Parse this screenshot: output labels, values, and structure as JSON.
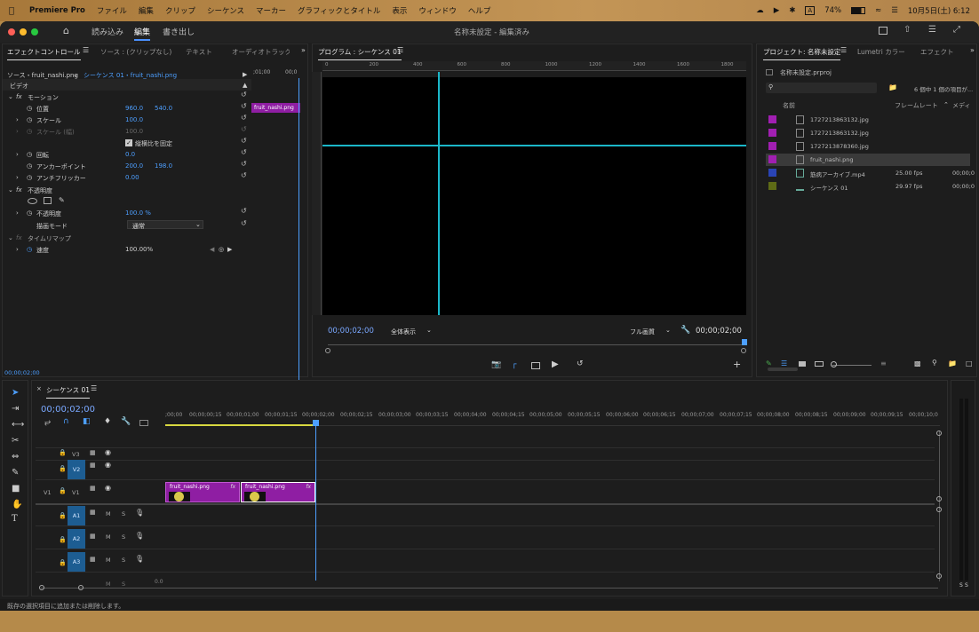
{
  "menubar": {
    "app": "Premiere Pro",
    "items": [
      "ファイル",
      "編集",
      "クリップ",
      "シーケンス",
      "マーカー",
      "グラフィックとタイトル",
      "表示",
      "ウィンドウ",
      "ヘルプ"
    ],
    "battery": "74%",
    "input": "A",
    "datetime": "10月5日(土) 6:12"
  },
  "titlebar": {
    "workspaces": [
      "読み込み",
      "編集",
      "書き出し"
    ],
    "active_workspace": "編集",
    "title": "名称未設定 - 編集済み"
  },
  "effect_controls": {
    "tabs": [
      "エフェクトコントロール",
      "ソース : (クリップなし)",
      "テキスト",
      "オーディオトラック"
    ],
    "source_label": "ソース・fruit_nashi.png",
    "sequence_label": "シーケンス 01・fruit_nashi.png",
    "clip_time_start": ";01;00",
    "clip_time_end": "00;0",
    "clip_name": "fruit_nashi.png",
    "section_video": "ビデオ",
    "motion": "モーション",
    "position_label": "位置",
    "position_x": "960.0",
    "position_y": "540.0",
    "scale_label": "スケール",
    "scale_value": "100.0",
    "scale_w_label": "スケール (幅)",
    "scale_w_value": "100.0",
    "uniform_scale": "縦横比を固定",
    "rotation_label": "回転",
    "rotation_value": "0.0",
    "anchor_label": "アンカーポイント",
    "anchor_x": "200.0",
    "anchor_y": "198.0",
    "antiflicker_label": "アンチフリッカー",
    "antiflicker_value": "0.00",
    "opacity_section": "不透明度",
    "opacity_label": "不透明度",
    "opacity_value": "100.0 %",
    "blend_label": "描画モード",
    "blend_value": "通常",
    "time_remap": "タイムリマップ",
    "speed_label": "速度",
    "speed_value": "100.00%",
    "bottom_time": "00;00;02;00"
  },
  "program": {
    "title": "プログラム : シーケンス 01",
    "ruler_labels": [
      "0",
      "200",
      "400",
      "600",
      "800",
      "1000",
      "1200",
      "1400",
      "1600",
      "1800"
    ],
    "timecode": "00;00;02;00",
    "fit": "全体表示",
    "quality": "フル画質",
    "duration": "00;00;02;00"
  },
  "project": {
    "tabs": [
      "プロジェクト: 名称未設定",
      "Lumetri カラー",
      "エフェクト"
    ],
    "file": "名称未設定.prproj",
    "count": "6 個中 1 個の項目が...",
    "col_name": "名前",
    "col_framerate": "フレームレート",
    "col_media": "メディ",
    "items": [
      {
        "name": "1727213863132.jpg",
        "fps": "",
        "media": "",
        "color": "#a11fb2"
      },
      {
        "name": "1727213863132.jpg",
        "fps": "",
        "media": "",
        "color": "#a11fb2"
      },
      {
        "name": "1727213878360.jpg",
        "fps": "",
        "media": "",
        "color": "#a11fb2"
      },
      {
        "name": "fruit_nashi.png",
        "fps": "",
        "media": "",
        "color": "#a11fb2"
      },
      {
        "name": "筋病アーカイブ.mp4",
        "fps": "25.00 fps",
        "media": "00;00;0",
        "color": "#2a44b5"
      },
      {
        "name": "シーケンス 01",
        "fps": "29.97 fps",
        "media": "00;00;0",
        "color": "#5e6b16"
      }
    ]
  },
  "timeline": {
    "tab": "シーケンス 01",
    "timecode": "00;00;02;00",
    "ticks": [
      ";00;00",
      "00;00;00;15",
      "00;00;01;00",
      "00;00;01;15",
      "00;00;02;00",
      "00;00;02;15",
      "00;00;03;00",
      "00;00;03;15",
      "00;00;04;00",
      "00;00;04;15",
      "00;00;05;00",
      "00;00;05;15",
      "00;00;06;00",
      "00;00;06;15",
      "00;00;07;00",
      "00;00;07;15",
      "00;00;08;00",
      "00;00;08;15",
      "00;00;09;00",
      "00;00;09;15",
      "00;00;10;0"
    ],
    "video_tracks": [
      "V3",
      "V2",
      "V1"
    ],
    "source_v1": "V1",
    "audio_tracks": [
      "A1",
      "A2",
      "A3"
    ],
    "mute": "M",
    "solo": "S",
    "mix_value": "0.0",
    "clips": [
      {
        "name": "fruit_nashi.png",
        "fx": "fx"
      },
      {
        "name": "fruit_nashi.png",
        "fx": "fx"
      }
    ],
    "meter_labels": [
      "S",
      "S"
    ]
  },
  "status": "既存の選択項目に追加または削除します。"
}
